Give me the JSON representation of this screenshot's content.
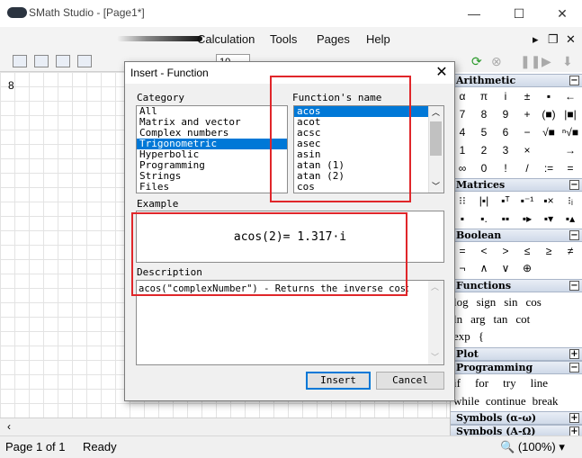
{
  "window": {
    "title": "SMath Studio - [Page1*]",
    "controls": {
      "minimize": "—",
      "maximize": "☐",
      "close": "✕"
    }
  },
  "menu": {
    "items": [
      "Calculation",
      "Tools",
      "Pages",
      "Help"
    ],
    "mdi_minimize": "▸",
    "mdi_restore": "❐",
    "mdi_close": "✕"
  },
  "toolbar": {
    "zoom_value": "10"
  },
  "document": {
    "value": "8"
  },
  "status": {
    "page": "Page 1 of 1",
    "state": "Ready",
    "zoom": "(100%)"
  },
  "dialog": {
    "title": "Insert - Function",
    "category_label": "Category",
    "categories": [
      "All",
      "Matrix and vector",
      "Complex numbers",
      "Trigonometric",
      "Hyperbolic",
      "Programming",
      "Strings",
      "Files"
    ],
    "selected_category": "Trigonometric",
    "function_label": "Function's name",
    "functions": [
      "acos",
      "acot",
      "acsc",
      "asec",
      "asin",
      "atan (1)",
      "atan (2)",
      "cos"
    ],
    "selected_function": "acos",
    "example_label": "Example",
    "example": "acos(2)= 1.317·i",
    "description_label": "Description",
    "description": "acos(\"complexNumber\") - Returns the inverse cosine.",
    "insert_label": "Insert",
    "cancel_label": "Cancel"
  },
  "palette": {
    "arithmetic": {
      "title": "Arithmetic",
      "rows": [
        [
          "α",
          "π",
          "i",
          "±",
          "▪",
          "←"
        ],
        [
          "7",
          "8",
          "9",
          "+",
          "(■)",
          "|■|"
        ],
        [
          "4",
          "5",
          "6",
          "−",
          "√■",
          "ⁿ√■"
        ],
        [
          "1",
          "2",
          "3",
          "×",
          "→"
        ],
        [
          "∞",
          "0",
          "!",
          "/",
          ":=",
          "="
        ]
      ]
    },
    "matrices": {
      "title": "Matrices"
    },
    "boolean": {
      "title": "Boolean",
      "rows": [
        [
          "=",
          "<",
          ">",
          "≤",
          "≥",
          "≠"
        ],
        [
          "¬",
          "∧",
          "∨",
          "⊕"
        ]
      ]
    },
    "functions": {
      "title": "Functions",
      "rows": [
        [
          "log",
          "sign",
          "sin",
          "cos"
        ],
        [
          "ln",
          "arg",
          "tan",
          "cot"
        ],
        [
          "exp",
          "{"
        ]
      ]
    },
    "plot": {
      "title": "Plot"
    },
    "programming": {
      "title": "Programming",
      "rows": [
        [
          "if",
          "for",
          "try",
          "line"
        ],
        [
          "while",
          "continue",
          "break"
        ]
      ]
    },
    "symbols1": {
      "title": "Symbols (α-ω)"
    },
    "symbols2": {
      "title": "Symbols (A-Ω)"
    }
  }
}
